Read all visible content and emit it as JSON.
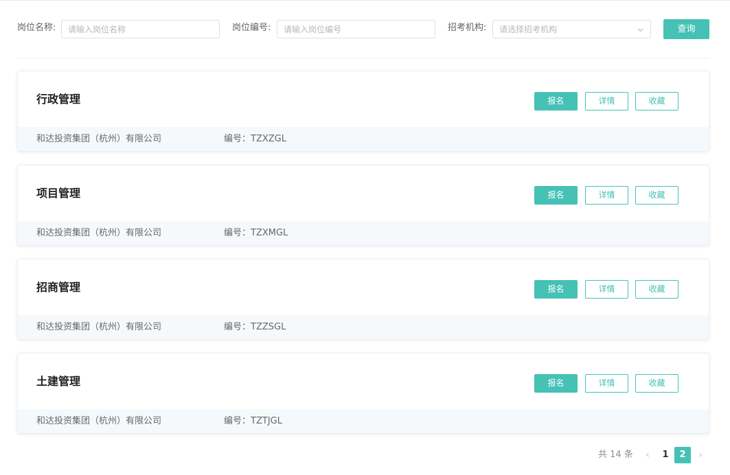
{
  "filters": {
    "position_name_label": "岗位名称:",
    "position_name_placeholder": "请输入岗位名称",
    "position_code_label": "岗位编号:",
    "position_code_placeholder": "请输入岗位编号",
    "org_label": "招考机构:",
    "org_placeholder": "请选择招考机构",
    "query_button": "查询"
  },
  "positions": [
    {
      "title": "行政管理",
      "company": "和达投资集团（杭州）有限公司",
      "code": "编号：TZXZGL",
      "apply": "报名",
      "detail": "详情",
      "favorite": "收藏"
    },
    {
      "title": "项目管理",
      "company": "和达投资集团（杭州）有限公司",
      "code": "编号：TZXMGL",
      "apply": "报名",
      "detail": "详情",
      "favorite": "收藏"
    },
    {
      "title": "招商管理",
      "company": "和达投资集团（杭州）有限公司",
      "code": "编号：TZZSGL",
      "apply": "报名",
      "detail": "详情",
      "favorite": "收藏"
    },
    {
      "title": "土建管理",
      "company": "和达投资集团（杭州）有限公司",
      "code": "编号：TZTJGL",
      "apply": "报名",
      "detail": "详情",
      "favorite": "收藏"
    }
  ],
  "pagination": {
    "total_text": "共 14 条",
    "prev": "‹",
    "pages": [
      "1",
      "2"
    ],
    "current_page": "2",
    "next": "›"
  },
  "colors": {
    "accent": "#45c1b5",
    "footer_bg": "#f6f9fb",
    "border": "#dcdfe6"
  }
}
